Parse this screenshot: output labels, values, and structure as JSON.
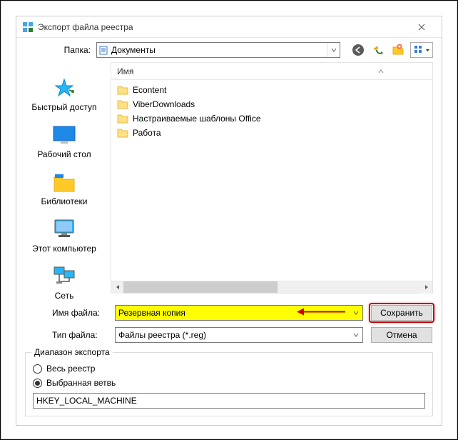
{
  "window": {
    "title": "Экспорт файла реестра"
  },
  "toprow": {
    "label": "Папка:",
    "folder": "Документы"
  },
  "places": {
    "quickaccess": "Быстрый доступ",
    "desktop": "Рабочий стол",
    "libraries": "Библиотеки",
    "thispc": "Этот компьютер",
    "network": "Сеть"
  },
  "list": {
    "header_name": "Имя",
    "items": [
      "Econtent",
      "ViberDownloads",
      "Настраиваемые шаблоны Office",
      "Работа"
    ]
  },
  "form": {
    "filename_label": "Имя файла:",
    "filename_value": "Резервная копия",
    "filetype_label": "Тип файла:",
    "filetype_value": "Файлы реестра (*.reg)",
    "save_label": "Сохранить",
    "cancel_label": "Отмена"
  },
  "export": {
    "group_title": "Диапазон экспорта",
    "radio_all": "Весь реестр",
    "radio_branch": "Выбранная ветвь",
    "branch_value": "HKEY_LOCAL_MACHINE"
  }
}
